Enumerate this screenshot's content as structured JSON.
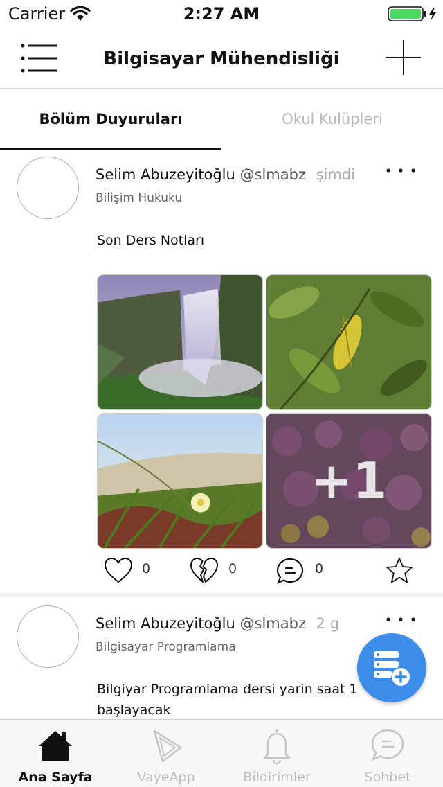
{
  "status_bar": {
    "carrier": "Carrier",
    "time": "2:27 AM",
    "battery_color": "#4cd964"
  },
  "nav": {
    "title": "Bilgisayar Mühendisliği",
    "menu_icon": "hamburger-menu-icon",
    "add_icon": "plus-icon"
  },
  "tabs": [
    {
      "label": "Bölüm Duyuruları",
      "active": true
    },
    {
      "label": "Okul Kulüpleri",
      "active": false
    }
  ],
  "posts": [
    {
      "author": "Selim Abuzeyitoğlu",
      "handle": "@slmabz",
      "time": "şimdi",
      "category": "Bilişim Hukuku",
      "text": "Son Ders Notları",
      "more_photos": "+1",
      "likes": "0",
      "dislikes": "0",
      "comments": "0"
    },
    {
      "author": "Selim Abuzeyitoğlu",
      "handle": "@slmabz",
      "time": "2 g",
      "category": "Bilgisayar Programlama",
      "text": "Bilgiyar Programlama dersi yarin saat 1 başlayacak"
    }
  ],
  "fab": {
    "icon": "server-add-icon",
    "color": "#3d8eea"
  },
  "tab_bar": [
    {
      "label": "Ana Sayfa",
      "icon": "home-icon",
      "active": true
    },
    {
      "label": "VayeApp",
      "icon": "vaye-logo-icon",
      "active": false
    },
    {
      "label": "Bildirimler",
      "icon": "bell-icon",
      "active": false
    },
    {
      "label": "Sohbet",
      "icon": "chat-icon",
      "active": false
    }
  ]
}
